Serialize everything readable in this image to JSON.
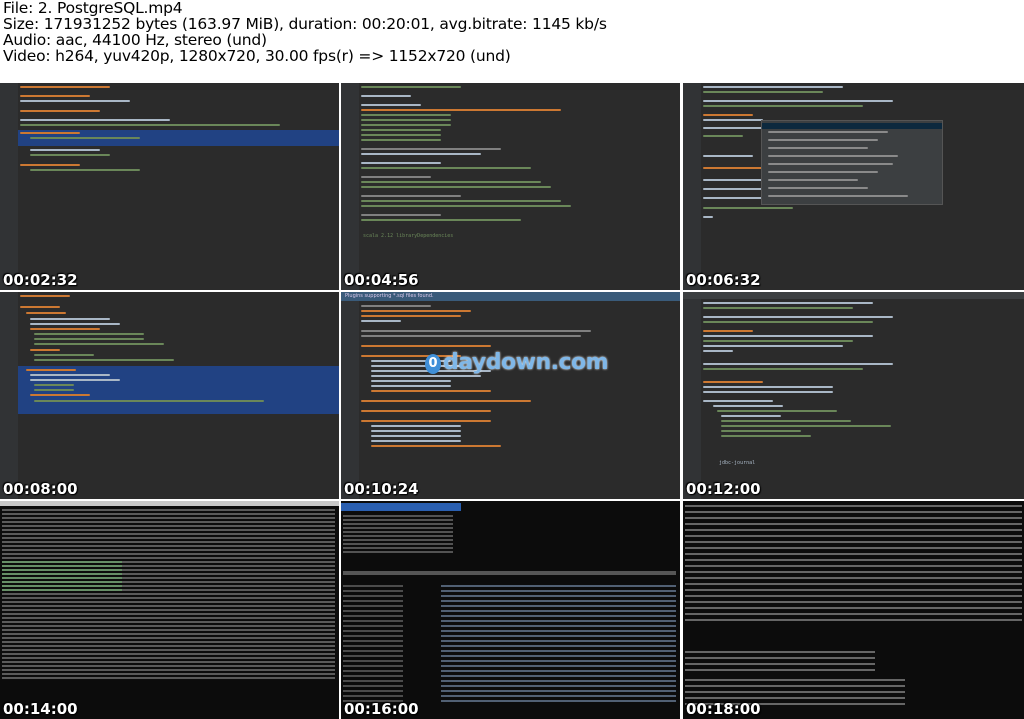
{
  "header": {
    "file_line": "File: 2. PostgreSQL.mp4",
    "size_line": "Size: 171931252 bytes (163.97 MiB), duration: 00:20:01, avg.bitrate: 1145 kb/s",
    "audio_line": "Audio: aac, 44100 Hz, stereo (und)",
    "video_line": "Video: h264, yuv420p, 1280x720, 30.00 fps(r) => 1152x720 (und)"
  },
  "thumbnails": [
    {
      "timestamp": "00:02:32",
      "kind": "editor"
    },
    {
      "timestamp": "00:04:56",
      "kind": "editor"
    },
    {
      "timestamp": "00:06:32",
      "kind": "editor-popup"
    },
    {
      "timestamp": "00:08:00",
      "kind": "editor"
    },
    {
      "timestamp": "00:10:24",
      "kind": "editor-sql"
    },
    {
      "timestamp": "00:12:00",
      "kind": "editor"
    },
    {
      "timestamp": "00:14:00",
      "kind": "terminal"
    },
    {
      "timestamp": "00:16:00",
      "kind": "terminal"
    },
    {
      "timestamp": "00:18:00",
      "kind": "terminal"
    }
  ],
  "watermark": {
    "icon_text": "0",
    "text": "daydown.com"
  },
  "tile_text": {
    "t2_line": "scala 2.12 libraryDependencies",
    "t5_notice": "Plugins supporting *.sql files found.",
    "t9_prompt": "jdbc-journal"
  }
}
